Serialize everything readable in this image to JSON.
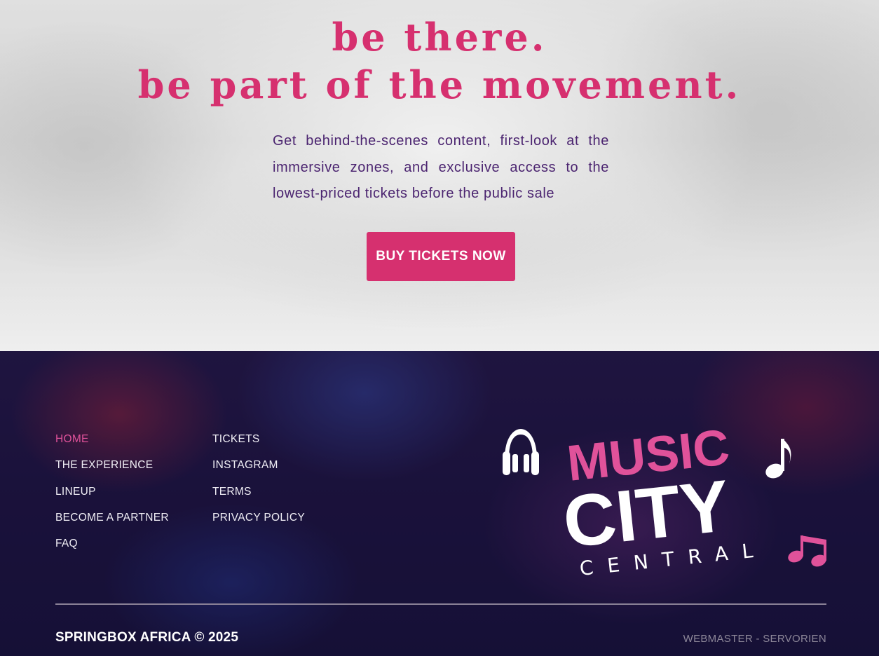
{
  "hero": {
    "headline_line1": "be there.",
    "headline_line2": "be part of the movement.",
    "subtitle": "Get behind-the-scenes content, first-look at the immersive zones, and exclusive access to the lowest-priced tickets before the public sale",
    "cta_label": "BUY TICKETS NOW"
  },
  "footer": {
    "nav_col1": [
      "HOME",
      "THE EXPERIENCE",
      "LINEUP",
      "BECOME A PARTNER",
      "FAQ"
    ],
    "nav_col2": [
      "TICKETS",
      "INSTAGRAM",
      "TERMS",
      "PRIVACY POLICY"
    ],
    "active_item": "HOME",
    "logo": {
      "line1": "MUSIC",
      "line2": "CITY",
      "line3": "CENTRAL",
      "icons": [
        "headphones-icon",
        "music-note-icon",
        "double-music-note-icon"
      ]
    },
    "copyright": "SPRINGBOX AFRICA © 2025",
    "credit": "WEBMASTER - SERVORIEN"
  },
  "colors": {
    "accent": "#d6306f",
    "subtitle_text": "#4b2470",
    "footer_bg": "#1c1240",
    "active_link": "#e0529a"
  }
}
